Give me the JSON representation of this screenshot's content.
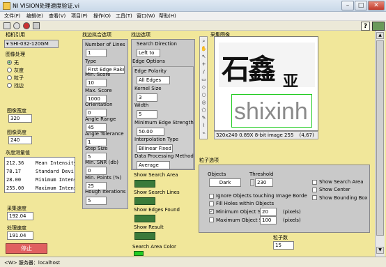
{
  "window": {
    "title": "NI VISION处理速度验证.vi"
  },
  "menu": [
    "文件(F)",
    "编辑(E)",
    "查看(V)",
    "项目(P)",
    "操作(O)",
    "工具(T)",
    "窗口(W)",
    "帮助(H)"
  ],
  "camera": {
    "label": "相机引用",
    "value": "SHI-032-120GM"
  },
  "image_proc": {
    "label": "图像处理",
    "options": [
      "无",
      "灰度",
      "粒子",
      "找边"
    ],
    "selected": 0
  },
  "image_width": {
    "label": "图像宽度",
    "value": "320"
  },
  "image_height": {
    "label": "图像高度",
    "value": "240"
  },
  "gray": {
    "label": "灰度测量值",
    "rows": [
      {
        "value": "212.36",
        "name": "Mean Intensity"
      },
      {
        "value": "78.17",
        "name": "Standard Devi"
      },
      {
        "value": "28.00",
        "name": "Minimum Intensi"
      },
      {
        "value": "255.00",
        "name": "Maximum Intensi"
      }
    ]
  },
  "acq_speed": {
    "label": "采集速度",
    "value": "192.04"
  },
  "proc_speed": {
    "label": "处理速度",
    "value": "191.04"
  },
  "stop": {
    "label": "停止"
  },
  "find_edge_options": {
    "label": "找边拟合选项",
    "number_of_lines": {
      "label": "Number of Lines",
      "value": "1"
    },
    "type": {
      "label": "Type",
      "value": "First Edge Rake"
    },
    "min_score": {
      "label": "Min. Score",
      "value": "10"
    },
    "max_score": {
      "label": "Max. Score",
      "value": "1000"
    },
    "orientation": {
      "label": "Orientation",
      "value": "0"
    },
    "angle_range": {
      "label": "Angle Range",
      "value": "45"
    },
    "angle_tolerance": {
      "label": "Angle Tolerance",
      "value": "1"
    },
    "step_size": {
      "label": "Step Size",
      "value": "5"
    },
    "min_snr": {
      "label": "Min. SNR (db)",
      "value": "0"
    },
    "min_points": {
      "label": "Min. Points (%)",
      "value": "25"
    },
    "hough_iterations": {
      "label": "Hough Iterations",
      "value": "5"
    }
  },
  "edge_opts": {
    "label": "找边选项",
    "search_direction": {
      "label": "Search Direction",
      "value": "Left to"
    },
    "edge_options_label": "Edge Options",
    "edge_polarity": {
      "label": "Edge Polarity",
      "value": "All Edges"
    },
    "kernel_size": {
      "label": "Kernel Size",
      "value": "3"
    },
    "width": {
      "label": "Width",
      "value": "5"
    },
    "min_edge_strength": {
      "label": "Minimum Edge Strength",
      "value": "50.00"
    },
    "interpolation": {
      "label": "Interpolation Type",
      "value": "Bilinear Fixed"
    },
    "data_processing": {
      "label": "Data Processing Method",
      "value": "Average"
    }
  },
  "show": {
    "search_area": "Show Search Area",
    "search_lines": "Show Search Lines",
    "edges_found": "Show Edges Found",
    "result": "Show Result",
    "search_area_color": "Search Area Color"
  },
  "image_view": {
    "label": "采集图像",
    "status": "320x240 0.89X 8-bit image 255",
    "coords": "(4,67)",
    "overlay_text": "shixinh"
  },
  "particle": {
    "label": "粒子选项",
    "objects": {
      "label": "Objects",
      "value": "Dark"
    },
    "threshold": {
      "label": "Threshold",
      "value": "230"
    },
    "ignore_border": "Ignore Objects touching Image Borde",
    "fill_holes": "Fill Holes within Objects",
    "min_obj": {
      "label": "Minimum Object S",
      "value": "20",
      "unit": "(pixels)",
      "checked": true
    },
    "max_obj": {
      "label": "Maximum Object S",
      "value": "100",
      "unit": "(pixels)",
      "checked": false
    },
    "show_search_area": "Show Search Area",
    "show_center": "Show Center",
    "show_bounding_box": "Show Bounding Box"
  },
  "particle_count": {
    "label": "粒子数",
    "value": "15"
  },
  "status": {
    "text": "<W> 服务器：localhost"
  }
}
